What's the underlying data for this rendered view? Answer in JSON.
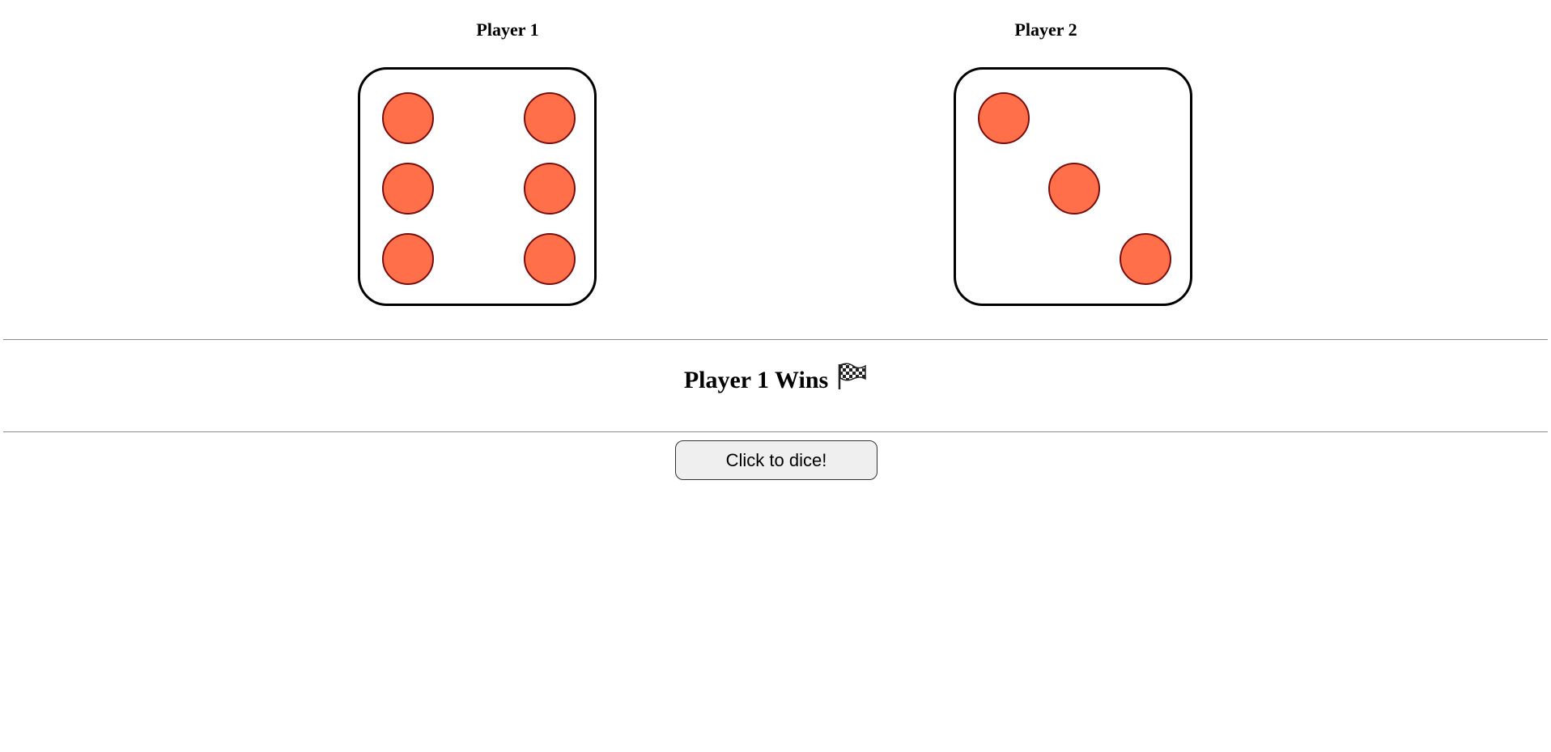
{
  "players": [
    {
      "title": "Player 1",
      "die_value": 6
    },
    {
      "title": "Player 2",
      "die_value": 3
    }
  ],
  "result": {
    "text": "Player 1 Wins",
    "icon": "checkered-flag-icon"
  },
  "button": {
    "label": "Click to dice!"
  },
  "colors": {
    "pip_fill": "#ff6f4a",
    "pip_stroke": "#7a0d0d",
    "die_border": "#000000"
  }
}
